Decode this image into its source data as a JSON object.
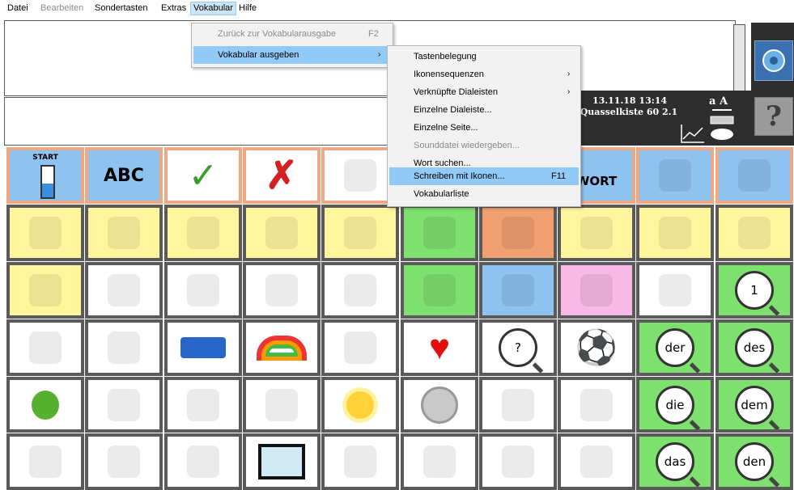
{
  "menubar": {
    "items": [
      {
        "label": "Datei",
        "state": "normal"
      },
      {
        "label": "Bearbeiten",
        "state": "disabled"
      },
      {
        "label": "Sondertasten",
        "state": "normal"
      },
      {
        "label": "Extras",
        "state": "normal"
      },
      {
        "label": "Vokabular",
        "state": "active"
      },
      {
        "label": "Hilfe",
        "state": "normal"
      }
    ]
  },
  "vokabular_menu": {
    "items": [
      {
        "label": "Zurück zur Vokabularausgabe",
        "shortcut": "F2",
        "disabled": true
      },
      {
        "label": "Vokabular ausgeben",
        "submenu": true,
        "highlighted": true
      }
    ]
  },
  "ausgeben_submenu": {
    "items": [
      {
        "label": "Tastenbelegung"
      },
      {
        "label": "Ikonensequenzen",
        "submenu": true
      },
      {
        "label": "Verknüpfte Dialeisten",
        "submenu": true
      },
      {
        "label": "Einzelne Dialeiste..."
      },
      {
        "label": "Einzelne Seite..."
      },
      {
        "label": "Sounddatei wiedergeben...",
        "disabled": true
      },
      {
        "label": "Wort suchen..."
      },
      {
        "label": "Schreiben mit Ikonen...",
        "shortcut": "F11",
        "highlighted": true
      },
      {
        "label": "Vokabularliste"
      }
    ]
  },
  "status": {
    "datetime": "13.11.18 13:14",
    "vocabulary": "5) Quasselkiste 60 2.1",
    "font_size_label": "a A"
  },
  "buttons": {
    "help": "?"
  },
  "grid": {
    "row0": [
      {
        "label": "START",
        "icon": "start-battery-icon",
        "bg": "#8fc3ef"
      },
      {
        "label": "ABC",
        "icon": "abc-icon",
        "bg": "#8fc3ef"
      },
      {
        "label": "",
        "icon": "checkmark-icon",
        "bg": "#ffffff"
      },
      {
        "label": "",
        "icon": "cross-icon",
        "bg": "#ffffff"
      },
      {
        "label": "",
        "icon": "waving-man-icon",
        "bg": "#ffffff"
      },
      {
        "label": "",
        "icon": "hidden",
        "bg": "#ffffff"
      },
      {
        "label": "",
        "icon": "hidden",
        "bg": "#ffffff"
      },
      {
        "label": "WORT",
        "icon": "eraser-word-icon",
        "bg": "#8fc3ef"
      },
      {
        "label": "",
        "icon": "wiper-icon",
        "bg": "#8fc3ef"
      },
      {
        "label": "",
        "icon": "eraser-star-icon",
        "bg": "#8fc3ef"
      }
    ],
    "row1": [
      {
        "icon": "person-self-icon",
        "bg": "#fff59d"
      },
      {
        "icon": "pointing-you-icon",
        "bg": "#fff59d"
      },
      {
        "icon": "boy-icon",
        "bg": "#fff59d"
      },
      {
        "icon": "girl-icon",
        "bg": "#fff59d"
      },
      {
        "icon": "sheep-icon",
        "bg": "#fff59d"
      },
      {
        "icon": "dinosaur-icon",
        "bg": "#7ee06e"
      },
      {
        "icon": "indian-chief-icon",
        "bg": "#f0a070"
      },
      {
        "icon": "couple-icon",
        "bg": "#fff59d"
      },
      {
        "icon": "pointing-both-icon",
        "bg": "#fff59d"
      },
      {
        "icon": "two-girls-icon",
        "bg": "#fff59d"
      }
    ],
    "row2": [
      {
        "icon": "wizard-icon",
        "bg": "#fff59d"
      },
      {
        "icon": "house-icon",
        "bg": "#ffffff"
      },
      {
        "icon": "hammer-icon",
        "bg": "#ffffff"
      },
      {
        "icon": "thumbs-down-icon",
        "bg": "#ffffff"
      },
      {
        "icon": "shirt-thumbs-up-icon",
        "bg": "#ffffff"
      },
      {
        "icon": "clock-tower-icon",
        "bg": "#7ee06e"
      },
      {
        "icon": "traffic-light-icon",
        "bg": "#8fc3ef"
      },
      {
        "icon": "mixing-bowl-icon",
        "bg": "#f8b8e8"
      },
      {
        "icon": "speech-box-icon",
        "bg": "#ffffff"
      },
      {
        "icon": "number-one-icon",
        "label": "1",
        "bg": "#7ee06e"
      }
    ],
    "row3": [
      {
        "icon": "flower-icon",
        "bg": "#ffffff"
      },
      {
        "icon": "family-icon",
        "bg": "#ffffff"
      },
      {
        "icon": "lego-brick-icon",
        "bg": "#ffffff"
      },
      {
        "icon": "rainbow-icon",
        "bg": "#ffffff"
      },
      {
        "icon": "teacher-icon",
        "bg": "#ffffff"
      },
      {
        "icon": "heart-icon",
        "bg": "#ffffff"
      },
      {
        "icon": "question-book-icon",
        "label": "?",
        "bg": "#ffffff"
      },
      {
        "icon": "soccer-ball-icon",
        "bg": "#ffffff"
      },
      {
        "icon": "word-der-icon",
        "label": "der",
        "bg": "#7ee06e"
      },
      {
        "icon": "word-des-icon",
        "label": "des",
        "bg": "#7ee06e"
      }
    ],
    "row4": [
      {
        "icon": "apple-icon",
        "bg": "#ffffff"
      },
      {
        "icon": "goblet-icon",
        "bg": "#ffffff"
      },
      {
        "icon": "van-icon",
        "bg": "#ffffff"
      },
      {
        "icon": "elephants-icon",
        "bg": "#ffffff"
      },
      {
        "icon": "sun-icon",
        "bg": "#ffffff"
      },
      {
        "icon": "coin-icon",
        "bg": "#ffffff"
      },
      {
        "icon": "dice-icon",
        "bg": "#ffffff"
      },
      {
        "icon": "toilet-icon",
        "bg": "#ffffff"
      },
      {
        "icon": "word-die-icon",
        "label": "die",
        "bg": "#7ee06e"
      },
      {
        "icon": "word-dem-icon",
        "label": "dem",
        "bg": "#7ee06e"
      }
    ],
    "row5": [
      {
        "icon": "mouse-icon",
        "bg": "#ffffff"
      },
      {
        "icon": "mother-child-icon",
        "bg": "#ffffff"
      },
      {
        "icon": "bed-icon",
        "bg": "#ffffff"
      },
      {
        "icon": "monitor-icon",
        "bg": "#ffffff"
      },
      {
        "icon": "swimmer-icon",
        "bg": "#ffffff"
      },
      {
        "icon": "prisoner-icon",
        "bg": "#ffffff"
      },
      {
        "icon": "idea-person-icon",
        "bg": "#ffffff"
      },
      {
        "icon": "worker-icon",
        "bg": "#ffffff"
      },
      {
        "icon": "word-das-icon",
        "label": "das",
        "bg": "#7ee06e"
      },
      {
        "icon": "word-den-icon",
        "label": "den",
        "bg": "#7ee06e"
      }
    ]
  }
}
